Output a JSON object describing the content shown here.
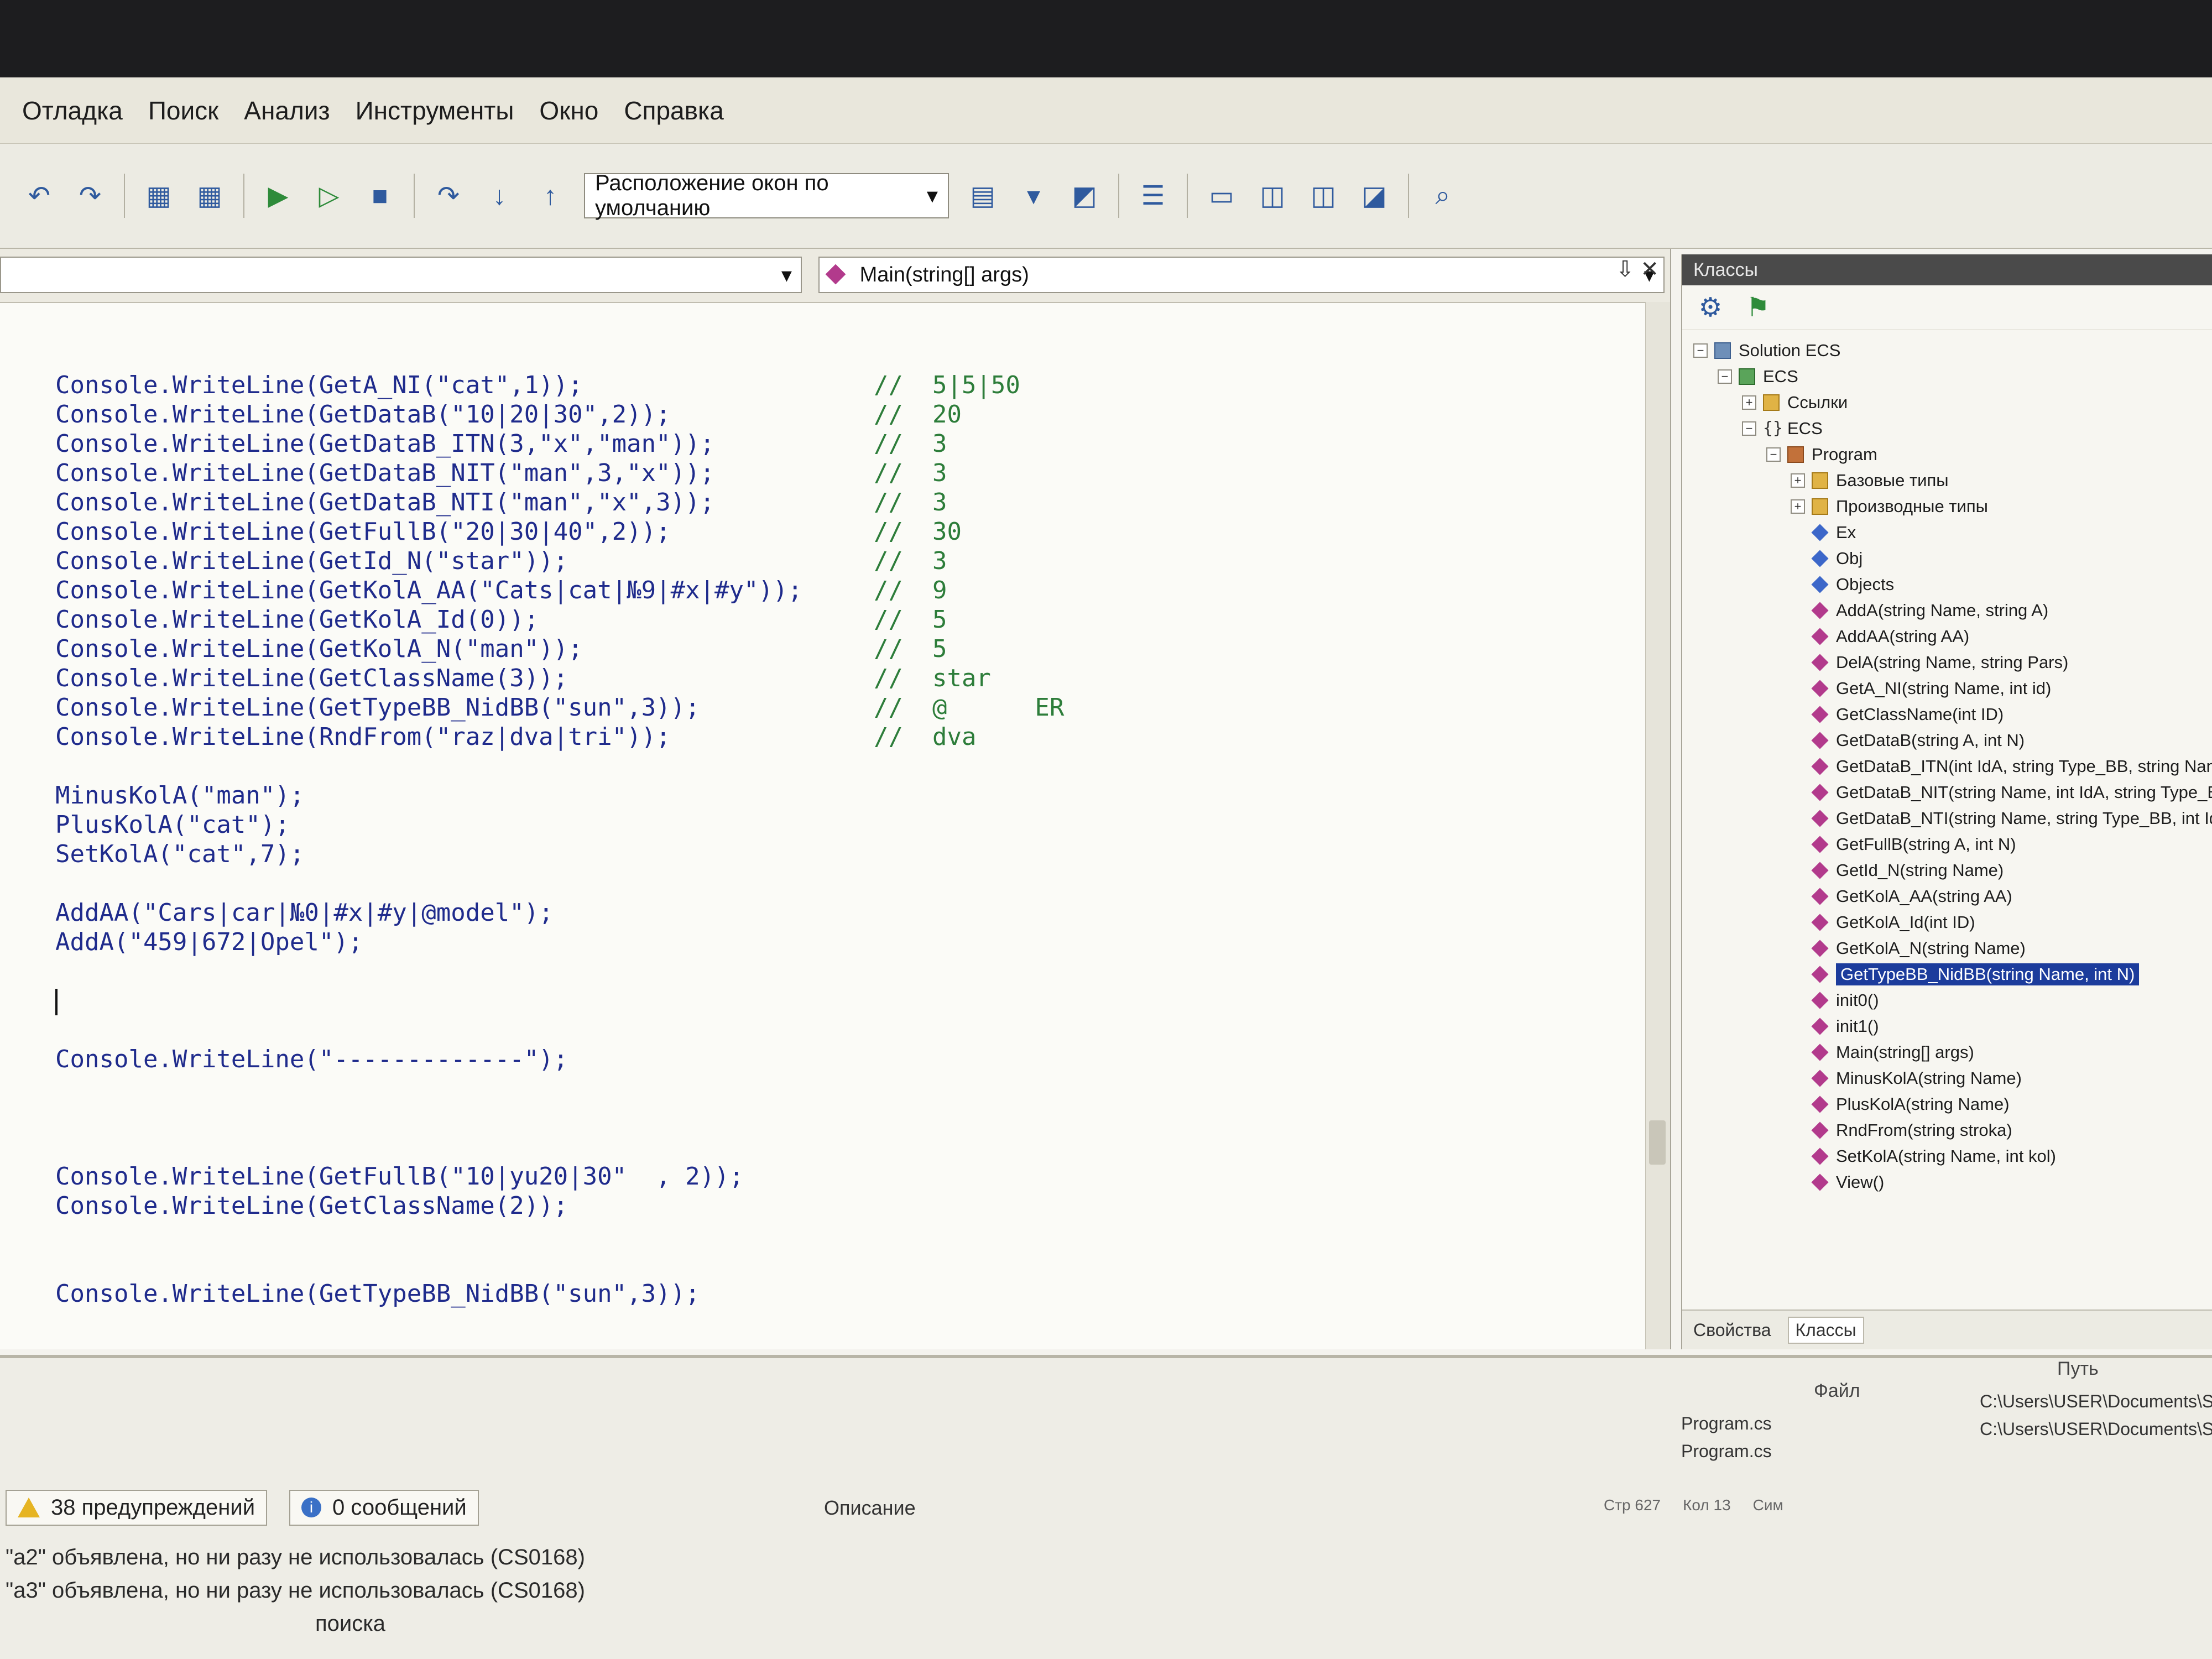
{
  "menu": [
    "Отладка",
    "Поиск",
    "Анализ",
    "Инструменты",
    "Окно",
    "Справка"
  ],
  "toolbar": {
    "layout_combo": "Расположение окон по умолчанию"
  },
  "editor": {
    "method_combo": "Main(string[] args)",
    "lines": [
      {
        "code": "Console.WriteLine(GetA_NI(\"cat\",1));",
        "comment": "//  5|5|50"
      },
      {
        "code": "Console.WriteLine(GetDataB(\"10|20|30\",2));",
        "comment": "//  20"
      },
      {
        "code": "Console.WriteLine(GetDataB_ITN(3,\"x\",\"man\"));",
        "comment": "//  3"
      },
      {
        "code": "Console.WriteLine(GetDataB_NIT(\"man\",3,\"x\"));",
        "comment": "//  3"
      },
      {
        "code": "Console.WriteLine(GetDataB_NTI(\"man\",\"x\",3));",
        "comment": "//  3"
      },
      {
        "code": "Console.WriteLine(GetFullB(\"20|30|40\",2));",
        "comment": "//  30"
      },
      {
        "code": "Console.WriteLine(GetId_N(\"star\"));",
        "comment": "//  3"
      },
      {
        "code": "Console.WriteLine(GetKolA_AA(\"Cats|cat|№9|#x|#y\"));",
        "comment": "//  9"
      },
      {
        "code": "Console.WriteLine(GetKolA_Id(0));",
        "comment": "//  5"
      },
      {
        "code": "Console.WriteLine(GetKolA_N(\"man\"));",
        "comment": "//  5"
      },
      {
        "code": "Console.WriteLine(GetClassName(3));",
        "comment": "//  star"
      },
      {
        "code": "Console.WriteLine(GetTypeBB_NidBB(\"sun\",3));",
        "comment": "//  @      ER"
      },
      {
        "code": "Console.WriteLine(RndFrom(\"raz|dva|tri\"));",
        "comment": "//  dva"
      },
      {
        "code": "",
        "comment": ""
      },
      {
        "code": "MinusKolA(\"man\");",
        "comment": ""
      },
      {
        "code": "PlusKolA(\"cat\");",
        "comment": ""
      },
      {
        "code": "SetKolA(\"cat\",7);",
        "comment": ""
      },
      {
        "code": "",
        "comment": ""
      },
      {
        "code": "AddAA(\"Cars|car|№0|#x|#y|@model\");",
        "comment": ""
      },
      {
        "code": "AddA(\"459|672|Opel\");",
        "comment": ""
      },
      {
        "code": "",
        "comment": ""
      },
      {
        "code": "|",
        "comment": ""
      },
      {
        "code": "",
        "comment": ""
      },
      {
        "code": "Console.WriteLine(\"-------------\");",
        "comment": ""
      },
      {
        "code": "",
        "comment": ""
      },
      {
        "code": "",
        "comment": ""
      },
      {
        "code": "",
        "comment": ""
      },
      {
        "code": "Console.WriteLine(GetFullB(\"10|yu20|30\"  , 2));",
        "comment": ""
      },
      {
        "code": "Console.WriteLine(GetClassName(2));",
        "comment": ""
      },
      {
        "code": "",
        "comment": ""
      },
      {
        "code": "",
        "comment": ""
      },
      {
        "code": "Console.WriteLine(GetTypeBB_NidBB(\"sun\",3));",
        "comment": ""
      }
    ]
  },
  "class_panel": {
    "title": "Классы",
    "tree": [
      {
        "label": "Solution ECS",
        "level": 0,
        "icon": "solution",
        "expander": "-"
      },
      {
        "label": "ECS",
        "level": 1,
        "icon": "project",
        "expander": "-"
      },
      {
        "label": "Ссылки",
        "level": 2,
        "icon": "folder",
        "expander": "+"
      },
      {
        "label": "ECS",
        "level": 2,
        "icon": "namespace",
        "expander": "-"
      },
      {
        "label": "Program",
        "level": 3,
        "icon": "class",
        "expander": "-"
      },
      {
        "label": "Базовые типы",
        "level": 4,
        "icon": "folder",
        "expander": "+"
      },
      {
        "label": "Производные типы",
        "level": 4,
        "icon": "folder",
        "expander": "+"
      },
      {
        "label": "Ex",
        "level": 4,
        "icon": "field"
      },
      {
        "label": "Obj",
        "level": 4,
        "icon": "field"
      },
      {
        "label": "Objects",
        "level": 4,
        "icon": "field"
      },
      {
        "label": "AddA(string Name, string A)",
        "level": 4,
        "icon": "method"
      },
      {
        "label": "AddAA(string AA)",
        "level": 4,
        "icon": "method"
      },
      {
        "label": "DelA(string Name, string Pars)",
        "level": 4,
        "icon": "method"
      },
      {
        "label": "GetA_NI(string Name, int id)",
        "level": 4,
        "icon": "method"
      },
      {
        "label": "GetClassName(int ID)",
        "level": 4,
        "icon": "method"
      },
      {
        "label": "GetDataB(string A, int N)",
        "level": 4,
        "icon": "method"
      },
      {
        "label": "GetDataB_ITN(int IdA, string Type_BB, string Name)",
        "level": 4,
        "icon": "method"
      },
      {
        "label": "GetDataB_NIT(string Name, int IdA, string Type_BB)",
        "level": 4,
        "icon": "method"
      },
      {
        "label": "GetDataB_NTI(string Name, string Type_BB, int IdA)",
        "level": 4,
        "icon": "method"
      },
      {
        "label": "GetFullB(string A, int N)",
        "level": 4,
        "icon": "method"
      },
      {
        "label": "GetId_N(string Name)",
        "level": 4,
        "icon": "method"
      },
      {
        "label": "GetKolA_AA(string AA)",
        "level": 4,
        "icon": "method"
      },
      {
        "label": "GetKolA_Id(int ID)",
        "level": 4,
        "icon": "method"
      },
      {
        "label": "GetKolA_N(string Name)",
        "level": 4,
        "icon": "method"
      },
      {
        "label": "GetTypeBB_NidBB(string Name, int N)",
        "level": 4,
        "icon": "method",
        "selected": true
      },
      {
        "label": "init0()",
        "level": 4,
        "icon": "method"
      },
      {
        "label": "init1()",
        "level": 4,
        "icon": "method"
      },
      {
        "label": "Main(string[] args)",
        "level": 4,
        "icon": "method"
      },
      {
        "label": "MinusKolA(string Name)",
        "level": 4,
        "icon": "method"
      },
      {
        "label": "PlusKolA(string Name)",
        "level": 4,
        "icon": "method"
      },
      {
        "label": "RndFrom(string stroka)",
        "level": 4,
        "icon": "method"
      },
      {
        "label": "SetKolA(string Name, int kol)",
        "level": 4,
        "icon": "method"
      },
      {
        "label": "View()",
        "level": 4,
        "icon": "method"
      }
    ],
    "tabs": [
      "Свойства",
      "Классы"
    ]
  },
  "errors": {
    "col_file": "Файл",
    "col_path": "Путь",
    "col_description": "Описание",
    "rows": [
      {
        "file": "Program.cs",
        "path": "C:\\Users\\USER\\Documents\\SharpDevel"
      },
      {
        "file": "Program.cs",
        "path": "C:\\Users\\USER\\Documents\\SharpDevel"
      }
    ],
    "warnings_label": "38 предупреждений",
    "messages_label": "0 сообщений",
    "messages": [
      "\"a2\" объявлена, но ни разу не использовалась (CS0168)",
      "\"a3\" объявлена, но ни разу не использовалась (CS0168)"
    ],
    "search_label": "поиска"
  },
  "status": [
    "Стр 627",
    "Кол 13",
    "Сим"
  ],
  "colors": {
    "keyword": "#1f2b8c",
    "comment": "#2d7d3a",
    "selection": "#1c3c9c"
  }
}
